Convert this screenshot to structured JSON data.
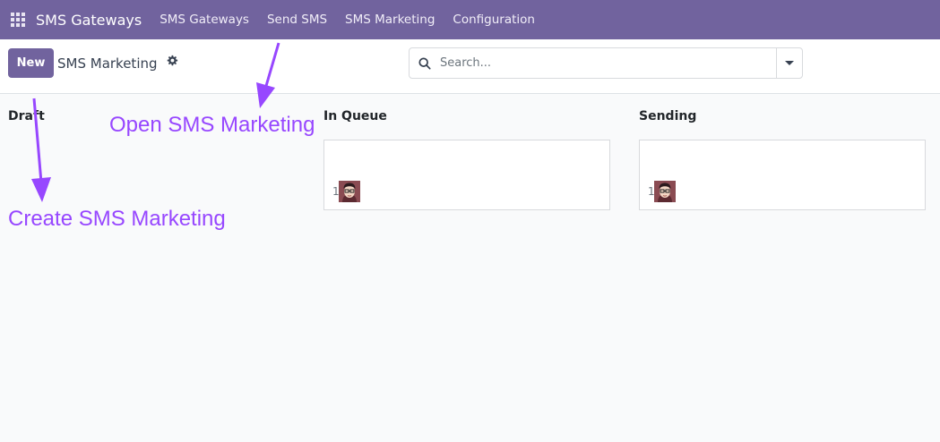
{
  "navbar": {
    "brand": "SMS Gateways",
    "menu": [
      "SMS Gateways",
      "Send SMS",
      "SMS Marketing",
      "Configuration"
    ]
  },
  "control": {
    "new_label": "New",
    "breadcrumb": "SMS Marketing",
    "search_placeholder": "Search..."
  },
  "kanban": {
    "columns": [
      {
        "title": "Draft"
      },
      {
        "title": "In Queue",
        "card_count": "1"
      },
      {
        "title": "Sending",
        "card_count": "1"
      }
    ]
  },
  "annotations": {
    "open": "Open SMS Marketing",
    "create": "Create SMS Marketing"
  },
  "colors": {
    "brand": "#71639e",
    "annotation": "#9747ff"
  },
  "icons": [
    "apps-grid-icon",
    "gear-icon",
    "search-icon",
    "caret-down-icon",
    "user-avatar-icon"
  ]
}
